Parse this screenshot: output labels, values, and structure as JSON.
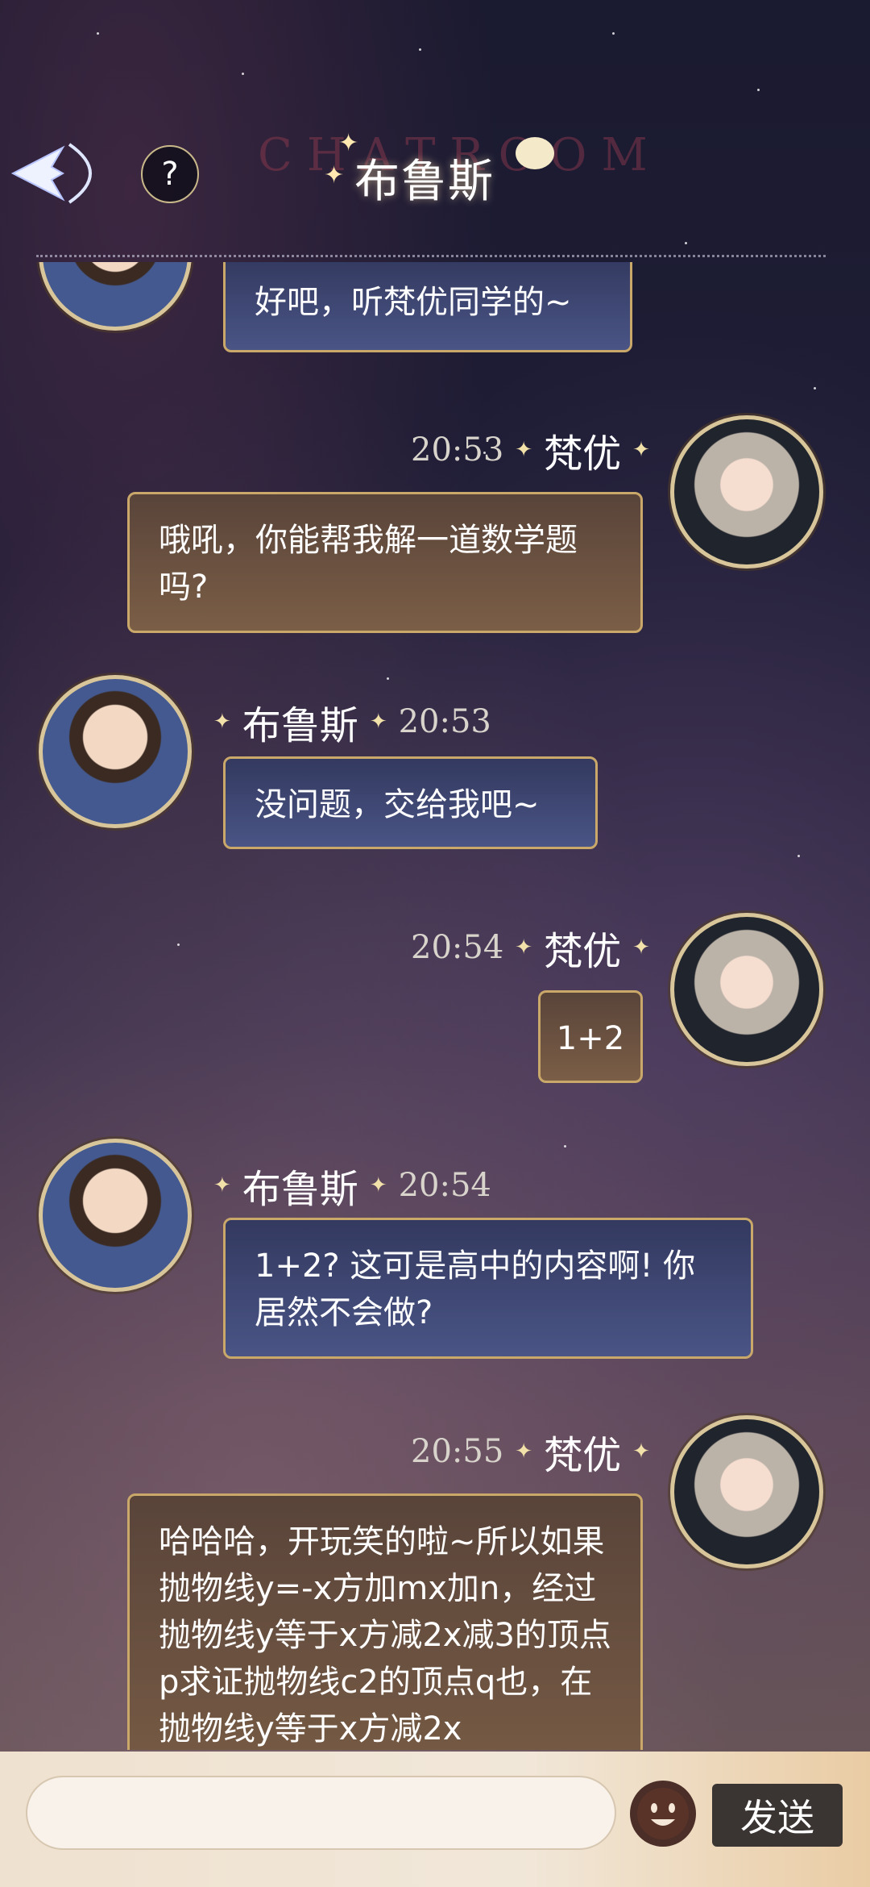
{
  "header": {
    "title": "布鲁斯",
    "watermark": "CHATROOM",
    "help_symbol": "?"
  },
  "messages": [
    {
      "side": "left",
      "avatar": "bruce-avatar",
      "text": "好吧，听梵优同学的~"
    },
    {
      "side": "right",
      "name": "梵优",
      "time": "20:53",
      "avatar": "fanyou-avatar",
      "text": "哦吼，你能帮我解一道数学题吗?"
    },
    {
      "side": "left",
      "name": "布鲁斯",
      "time": "20:53",
      "avatar": "bruce-avatar",
      "text": "没问题，交给我吧~"
    },
    {
      "side": "right",
      "name": "梵优",
      "time": "20:54",
      "avatar": "fanyou-avatar",
      "text": "1+2"
    },
    {
      "side": "left",
      "name": "布鲁斯",
      "time": "20:54",
      "avatar": "bruce-avatar",
      "text": "1+2? 这可是高中的内容啊! 你居然不会做?"
    },
    {
      "side": "right",
      "name": "梵优",
      "time": "20:55",
      "avatar": "fanyou-avatar",
      "text": "哈哈哈，开玩笑的啦~所以如果抛物线y=-x方加mx加n，经过抛物线y等于x方减2x减3的顶点p求证抛物线c2的顶点q也，在抛物线y等于x方减2x"
    }
  ],
  "input": {
    "placeholder": "",
    "send_label": "发送"
  },
  "colors": {
    "bubble_left": "#3b4470",
    "bubble_right": "#6a513f",
    "bubble_border": "#c9a86a",
    "send_bg": "#3a3433"
  }
}
